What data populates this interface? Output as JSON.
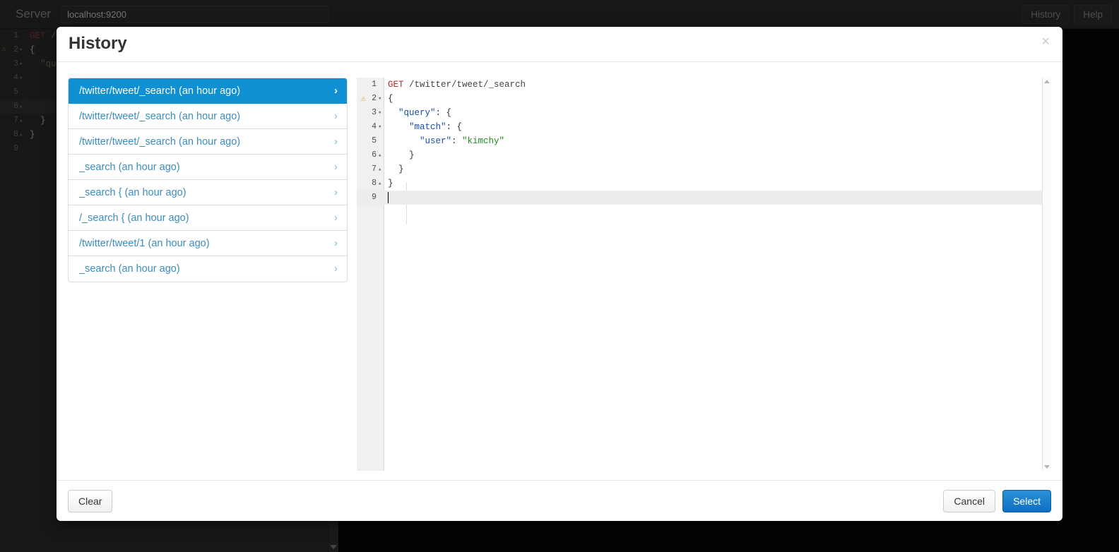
{
  "topbar": {
    "server_label": "Server",
    "server_value": "localhost:9200",
    "server_placeholder": "localhost:9200",
    "history_label": "History",
    "help_label": "Help"
  },
  "background_editor": {
    "lines": [
      {
        "n": "1",
        "fold": "",
        "warn": false,
        "text": "GET /t"
      },
      {
        "n": "2",
        "fold": "▾",
        "warn": true,
        "text": "{"
      },
      {
        "n": "3",
        "fold": "▾",
        "warn": false,
        "text": "  \"qu"
      },
      {
        "n": "4",
        "fold": "▾",
        "warn": false,
        "text": ""
      },
      {
        "n": "5",
        "fold": "",
        "warn": false,
        "text": ""
      },
      {
        "n": "6",
        "fold": "▴",
        "warn": false,
        "text": ""
      },
      {
        "n": "7",
        "fold": "▴",
        "warn": false,
        "text": "  }"
      },
      {
        "n": "8",
        "fold": "▴",
        "warn": false,
        "text": "}"
      },
      {
        "n": "9",
        "fold": "",
        "warn": false,
        "text": ""
      }
    ]
  },
  "modal": {
    "title": "History",
    "close_label": "×",
    "history_items": [
      {
        "label": "/twitter/tweet/_search (an hour ago)",
        "active": true
      },
      {
        "label": "/twitter/tweet/_search (an hour ago)",
        "active": false
      },
      {
        "label": "/twitter/tweet/_search (an hour ago)",
        "active": false
      },
      {
        "label": "_search (an hour ago)",
        "active": false
      },
      {
        "label": "_search { (an hour ago)",
        "active": false
      },
      {
        "label": "/_search { (an hour ago)",
        "active": false
      },
      {
        "label": "/twitter/tweet/1 (an hour ago)",
        "active": false
      },
      {
        "label": "_search (an hour ago)",
        "active": false
      }
    ],
    "chevron": "›",
    "editor": {
      "warning_glyph": "⚠",
      "lines": [
        {
          "n": "1",
          "fold": "",
          "warn": false,
          "active": false,
          "tokens": [
            {
              "t": "GET",
              "c": "kw"
            },
            {
              "t": " /twitter/tweet/_search",
              "c": "url"
            }
          ]
        },
        {
          "n": "2",
          "fold": "▾",
          "warn": true,
          "active": false,
          "tokens": [
            {
              "t": "{",
              "c": "plain"
            }
          ]
        },
        {
          "n": "3",
          "fold": "▾",
          "warn": false,
          "active": false,
          "tokens": [
            {
              "t": "  ",
              "c": "plain"
            },
            {
              "t": "\"query\"",
              "c": "prop"
            },
            {
              "t": ": {",
              "c": "plain"
            }
          ]
        },
        {
          "n": "4",
          "fold": "▾",
          "warn": false,
          "active": false,
          "tokens": [
            {
              "t": "    ",
              "c": "plain"
            },
            {
              "t": "\"match\"",
              "c": "prop"
            },
            {
              "t": ": {",
              "c": "plain"
            }
          ]
        },
        {
          "n": "5",
          "fold": "",
          "warn": false,
          "active": false,
          "tokens": [
            {
              "t": "      ",
              "c": "plain"
            },
            {
              "t": "\"user\"",
              "c": "prop"
            },
            {
              "t": ": ",
              "c": "plain"
            },
            {
              "t": "\"kimchy\"",
              "c": "strval"
            }
          ]
        },
        {
          "n": "6",
          "fold": "▴",
          "warn": false,
          "active": false,
          "tokens": [
            {
              "t": "    }",
              "c": "plain"
            }
          ]
        },
        {
          "n": "7",
          "fold": "▴",
          "warn": false,
          "active": false,
          "tokens": [
            {
              "t": "  }",
              "c": "plain"
            }
          ]
        },
        {
          "n": "8",
          "fold": "▴",
          "warn": false,
          "active": false,
          "tokens": [
            {
              "t": "}",
              "c": "plain"
            }
          ]
        },
        {
          "n": "9",
          "fold": "",
          "warn": false,
          "active": true,
          "cursor": true,
          "tokens": []
        }
      ]
    },
    "footer": {
      "clear_label": "Clear",
      "cancel_label": "Cancel",
      "select_label": "Select"
    }
  },
  "colors": {
    "accent": "#0e90d2",
    "primary_button": "#1a7ec8",
    "link": "#3b8dbd",
    "warning": "#e8a33d",
    "string": "#228b22",
    "keyword": "#b02c2c",
    "property": "#1a4fa0",
    "topbar_bg": "#2b2b2b",
    "output_bg": "#070707"
  }
}
